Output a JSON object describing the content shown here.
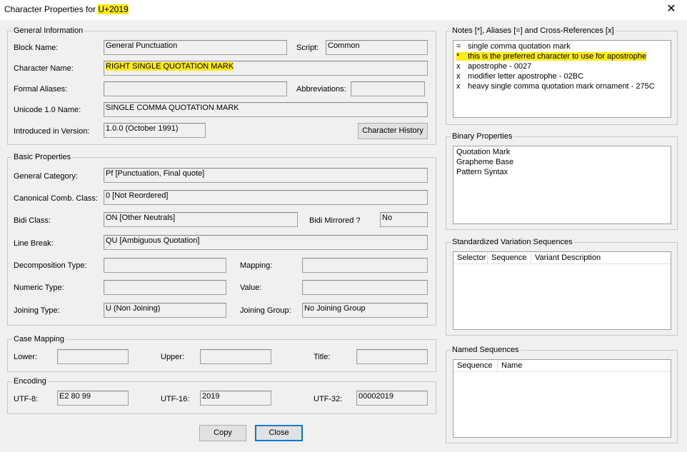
{
  "window": {
    "title_prefix": "Character Properties for ",
    "title_code": "U+2019"
  },
  "general": {
    "legend": "General Information",
    "block_label": "Block Name:",
    "block_value": "General Punctuation",
    "script_label": "Script:",
    "script_value": "Common",
    "name_label": "Character Name:",
    "name_value": "RIGHT SINGLE QUOTATION MARK",
    "aliases_label": "Formal Aliases:",
    "aliases_value": "",
    "abbrev_label": "Abbreviations:",
    "abbrev_value": "",
    "unicode1_label": "Unicode 1.0 Name:",
    "unicode1_value": "SINGLE COMMA QUOTATION MARK",
    "version_label": "Introduced in Version:",
    "version_value": "1.0.0 (October 1991)",
    "history_button": "Character History"
  },
  "basic": {
    "legend": "Basic Properties",
    "gc_label": "General Category:",
    "gc_value": "Pf [Punctuation, Final quote]",
    "ccc_label": "Canonical Comb. Class:",
    "ccc_value": "0 [Not Reordered]",
    "bidi_label": "Bidi Class:",
    "bidi_value": "ON [Other Neutrals]",
    "mirrored_label": "Bidi Mirrored ?",
    "mirrored_value": "No",
    "lb_label": "Line Break:",
    "lb_value": "QU [Ambiguous Quotation]",
    "decomp_label": "Decomposition Type:",
    "decomp_value": "",
    "mapping_label": "Mapping:",
    "mapping_value": "",
    "numeric_label": "Numeric Type:",
    "numeric_value": "",
    "value_label": "Value:",
    "value_value": "",
    "jt_label": "Joining Type:",
    "jt_value": "U (Non Joining)",
    "jg_label": "Joining Group:",
    "jg_value": "No Joining Group"
  },
  "case": {
    "legend": "Case Mapping",
    "lower_label": "Lower:",
    "upper_label": "Upper:",
    "title_label": "Title:",
    "lower_value": "",
    "upper_value": "",
    "title_value": ""
  },
  "encoding": {
    "legend": "Encoding",
    "utf8_label": "UTF-8:",
    "utf8_value": "E2 80 99",
    "utf16_label": "UTF-16:",
    "utf16_value": "2019",
    "utf32_label": "UTF-32:",
    "utf32_value": "00002019"
  },
  "notes": {
    "legend": "Notes [*], Aliases [=] and Cross-References [x]",
    "items": [
      {
        "mark": "=",
        "text": "single comma quotation mark"
      },
      {
        "mark": "*",
        "text": "this is the preferred character to use for apostrophe"
      },
      {
        "mark": "x",
        "text": "apostrophe - 0027"
      },
      {
        "mark": "x",
        "text": "modifier letter apostrophe - 02BC"
      },
      {
        "mark": "x",
        "text": "heavy single comma quotation mark ornament - 275C"
      }
    ]
  },
  "binary": {
    "legend": "Binary Properties",
    "items": [
      "Quotation Mark",
      "Grapheme Base",
      "Pattern Syntax"
    ]
  },
  "svs": {
    "legend": "Standardized Variation Sequences",
    "columns": [
      "Selector",
      "Sequence",
      "Variant Description"
    ]
  },
  "named": {
    "legend": "Named Sequences",
    "columns": [
      "Sequence",
      "Name"
    ]
  },
  "buttons": {
    "copy": "Copy",
    "close": "Close"
  },
  "colors": {
    "highlight": "#ffea1a",
    "focus": "#0078d7"
  }
}
